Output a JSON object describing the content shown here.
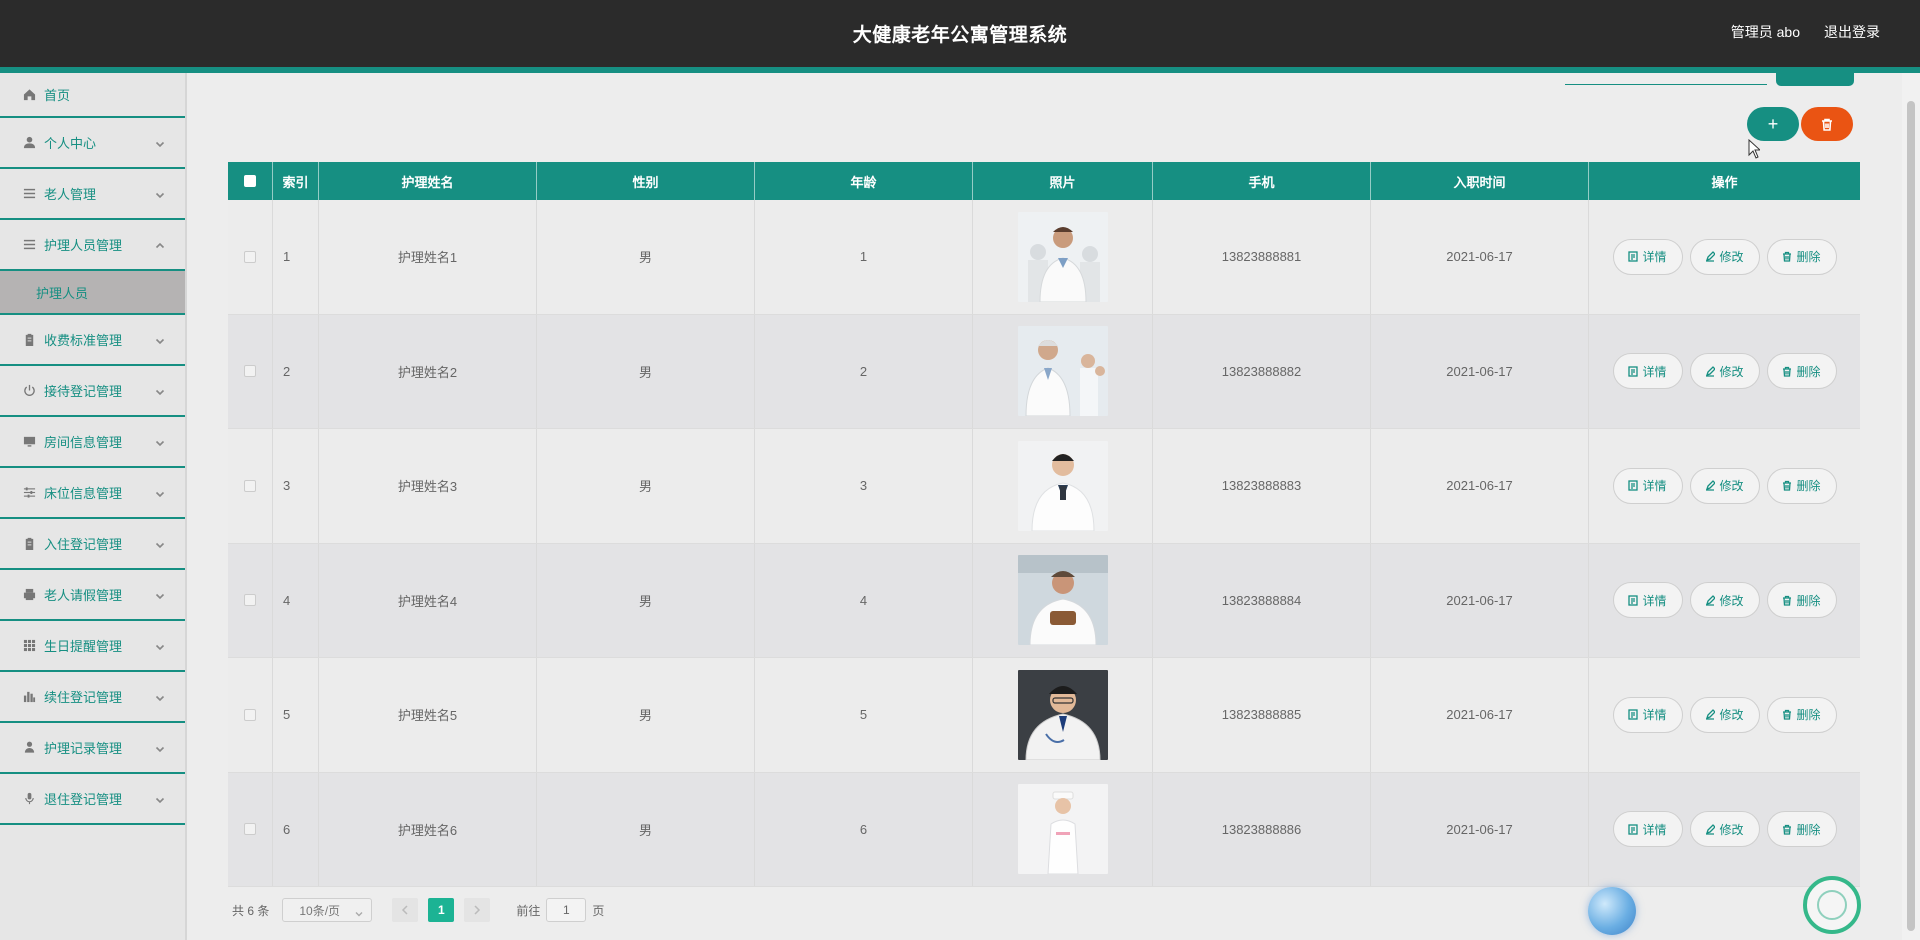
{
  "header": {
    "title": "大健康老年公寓管理系统",
    "admin": "管理员 abo",
    "logout": "退出登录"
  },
  "sidebar": {
    "items": [
      {
        "label": "首页",
        "icon": "home-icon"
      },
      {
        "label": "个人中心",
        "icon": "user-icon"
      },
      {
        "label": "老人管理",
        "icon": "list-icon"
      },
      {
        "label": "护理人员管理",
        "icon": "list-icon",
        "expanded": true,
        "children": [
          {
            "label": "护理人员"
          }
        ]
      },
      {
        "label": "收费标准管理",
        "icon": "clipboard-icon"
      },
      {
        "label": "接待登记管理",
        "icon": "power-icon"
      },
      {
        "label": "房间信息管理",
        "icon": "monitor-icon"
      },
      {
        "label": "床位信息管理",
        "icon": "sliders-icon"
      },
      {
        "label": "入住登记管理",
        "icon": "clipboard-icon"
      },
      {
        "label": "老人请假管理",
        "icon": "printer-icon"
      },
      {
        "label": "生日提醒管理",
        "icon": "grid-icon"
      },
      {
        "label": "续住登记管理",
        "icon": "bar-chart-icon"
      },
      {
        "label": "护理记录管理",
        "icon": "person-icon"
      },
      {
        "label": "退住登记管理",
        "icon": "mic-icon"
      }
    ]
  },
  "toolbar": {
    "add_label": "+"
  },
  "table": {
    "columns": [
      "索引",
      "护理姓名",
      "性别",
      "年龄",
      "照片",
      "手机",
      "入职时间",
      "操作"
    ],
    "rows": [
      {
        "index": "1",
        "name": "护理姓名1",
        "sex": "男",
        "age": "1",
        "phone": "13823888881",
        "date": "2021-06-17"
      },
      {
        "index": "2",
        "name": "护理姓名2",
        "sex": "男",
        "age": "2",
        "phone": "13823888882",
        "date": "2021-06-17"
      },
      {
        "index": "3",
        "name": "护理姓名3",
        "sex": "男",
        "age": "3",
        "phone": "13823888883",
        "date": "2021-06-17"
      },
      {
        "index": "4",
        "name": "护理姓名4",
        "sex": "男",
        "age": "4",
        "phone": "13823888884",
        "date": "2021-06-17"
      },
      {
        "index": "5",
        "name": "护理姓名5",
        "sex": "男",
        "age": "5",
        "phone": "13823888885",
        "date": "2021-06-17"
      },
      {
        "index": "6",
        "name": "护理姓名6",
        "sex": "男",
        "age": "6",
        "phone": "13823888886",
        "date": "2021-06-17"
      }
    ],
    "actions": {
      "detail": "详情",
      "edit": "修改",
      "delete": "删除"
    }
  },
  "pagination": {
    "total": "共 6 条",
    "page_size": "10条/页",
    "current_page": "1",
    "goto_prefix": "前往",
    "goto_value": "1",
    "goto_suffix": "页"
  },
  "colors": {
    "brand": "#168f82",
    "danger": "#ea5413",
    "header_bg": "#2b2b2b",
    "page_active": "#1cb394"
  }
}
